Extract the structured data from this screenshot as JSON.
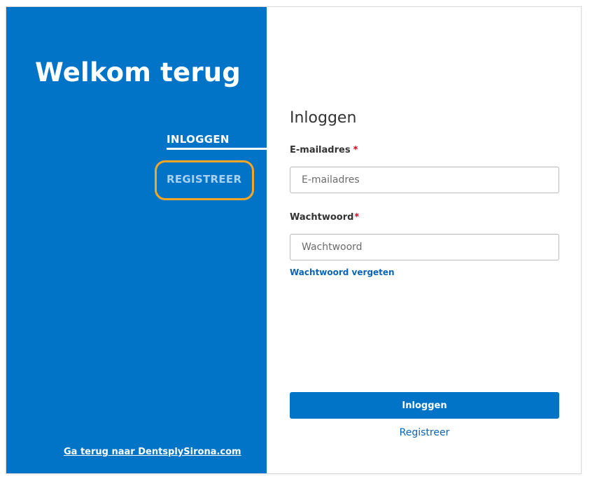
{
  "welcome": {
    "title": "Welkom terug"
  },
  "tabs": {
    "login": "INLOGGEN",
    "register": "REGISTREER"
  },
  "back_link": "Ga terug naar DentsplySirona.com",
  "form": {
    "title": "Inloggen",
    "email": {
      "label": "E-mailadres",
      "required_mark": "*",
      "placeholder": "E-mailadres",
      "value": ""
    },
    "password": {
      "label": "Wachtwoord",
      "required_mark": "*",
      "placeholder": "Wachtwoord",
      "value": ""
    },
    "forgot_link": "Wachtwoord vergeten",
    "submit_label": "Inloggen",
    "register_link": "Registreer"
  },
  "colors": {
    "brand_blue": "#0174c8",
    "link_blue": "#0b64b4",
    "highlight_orange": "#f5a623",
    "required_red": "#d0021b",
    "inactive_tab": "#a9d2f2"
  }
}
